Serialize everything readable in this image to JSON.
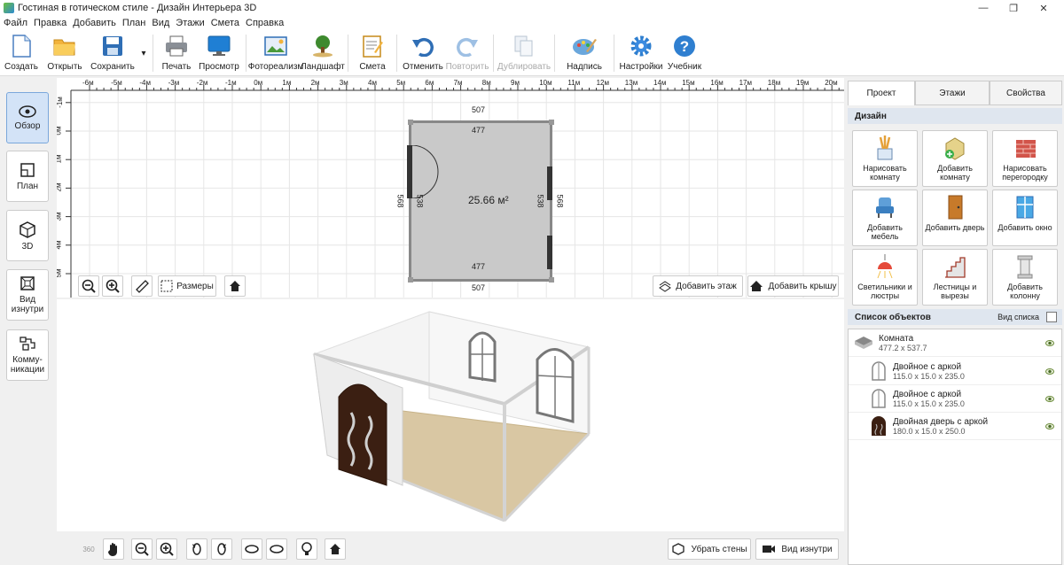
{
  "window": {
    "title": "Гостиная в готическом стиле - Дизайн Интерьера 3D",
    "controls": [
      "—",
      "❐",
      "✕"
    ]
  },
  "menu": [
    "Файл",
    "Правка",
    "Добавить",
    "План",
    "Вид",
    "Этажи",
    "Смета",
    "Справка"
  ],
  "toolbar": {
    "create": "Создать",
    "open": "Открыть",
    "save": "Сохранить",
    "save_dropdown": "▾",
    "print": "Печать",
    "preview": "Просмотр",
    "photorealism": "Фотореализм",
    "landscape": "Ландшафт",
    "estimate": "Смета",
    "undo": "Отменить",
    "redo": "Повторить",
    "duplicate": "Дублировать",
    "label": "Надпись",
    "settings": "Настройки",
    "tutorial": "Учебник"
  },
  "left_nav": {
    "overview": "Обзор",
    "plan": "План",
    "view3d": "3D",
    "inside_view": "Вид изнутри",
    "communications": "Комму-никации"
  },
  "plan": {
    "ruler_x": [
      "-6м",
      "-5м",
      "-4м",
      "-3м",
      "-2м",
      "-1м",
      "0м",
      "1м",
      "2м",
      "3м",
      "4м",
      "5м",
      "6м",
      "7м",
      "8м",
      "9м",
      "10м",
      "11м",
      "12м",
      "13м",
      "14м",
      "15м",
      "16м",
      "17м",
      "18м",
      "19м",
      "20м"
    ],
    "ruler_y": [
      "-1м",
      "0м",
      "1м",
      "2м",
      "3м",
      "4м",
      "5м"
    ],
    "dim_top_outer": "507",
    "dim_top_inner": "477",
    "dim_bottom_inner": "477",
    "dim_bottom_outer": "507",
    "dim_left_outer": "568",
    "dim_left_inner": "538",
    "dim_right_inner": "538",
    "dim_right_outer": "568",
    "area": "25.66 м²",
    "sizes_label": "Размеры",
    "add_floor": "Добавить этаж",
    "add_roof": "Добавить крышу"
  },
  "view3d": {
    "remove_walls": "Убрать стены",
    "inside_view": "Вид изнутри",
    "rotate360": "360"
  },
  "right_panel": {
    "tabs": [
      "Проект",
      "Этажи",
      "Свойства"
    ],
    "design_header": "Дизайн",
    "design_buttons": [
      {
        "label": "Нарисовать комнату"
      },
      {
        "label": "Добавить комнату"
      },
      {
        "label": "Нарисовать перегородку"
      },
      {
        "label": "Добавить мебель"
      },
      {
        "label": "Добавить дверь"
      },
      {
        "label": "Добавить окно"
      },
      {
        "label": "Светильники и люстры"
      },
      {
        "label": "Лестницы и вырезы"
      },
      {
        "label": "Добавить колонну"
      }
    ],
    "objects_header": "Список объектов",
    "list_view": "Вид списка",
    "objects": [
      {
        "name": "Комната",
        "dims": "477.2 x 537.7"
      },
      {
        "name": "Двойное с аркой",
        "dims": "115.0 x 15.0 x 235.0"
      },
      {
        "name": "Двойное с аркой",
        "dims": "115.0 x 15.0 x 235.0"
      },
      {
        "name": "Двойная дверь с аркой",
        "dims": "180.0 x 15.0 x 250.0"
      }
    ]
  },
  "colors": {
    "floor": "#d9c7a3",
    "door": "#3b1f12",
    "active_tab": "#d3e3f7",
    "section_header": "#dfe6ef"
  }
}
